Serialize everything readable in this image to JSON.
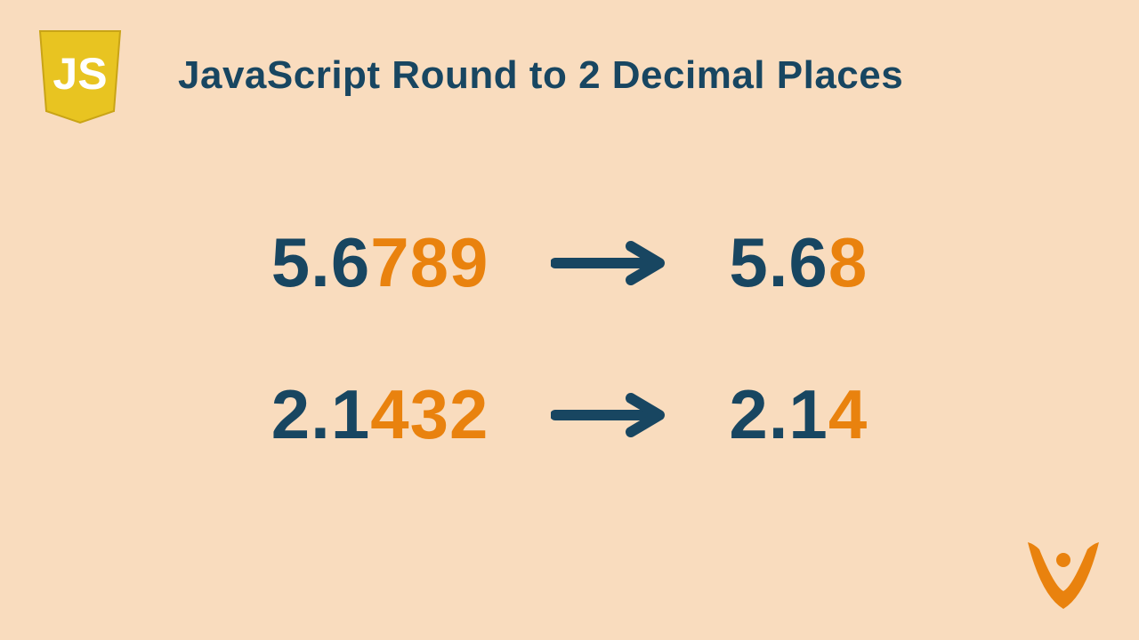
{
  "title": "JavaScript Round to 2 Decimal Places",
  "colors": {
    "background": "#f9dcbe",
    "dark": "#184661",
    "accent": "#e9820e",
    "js_yellow": "#e8c421",
    "js_white": "#ffffff"
  },
  "examples": [
    {
      "before_dark": "5.6",
      "before_orange": "789",
      "after_dark": "5.6",
      "after_orange": "8"
    },
    {
      "before_dark": "2.1",
      "before_orange": "432",
      "after_dark": "2.1",
      "after_orange": "4"
    }
  ],
  "icons": {
    "js": "js-logo",
    "arrow": "arrow-right",
    "person": "victory-person"
  }
}
